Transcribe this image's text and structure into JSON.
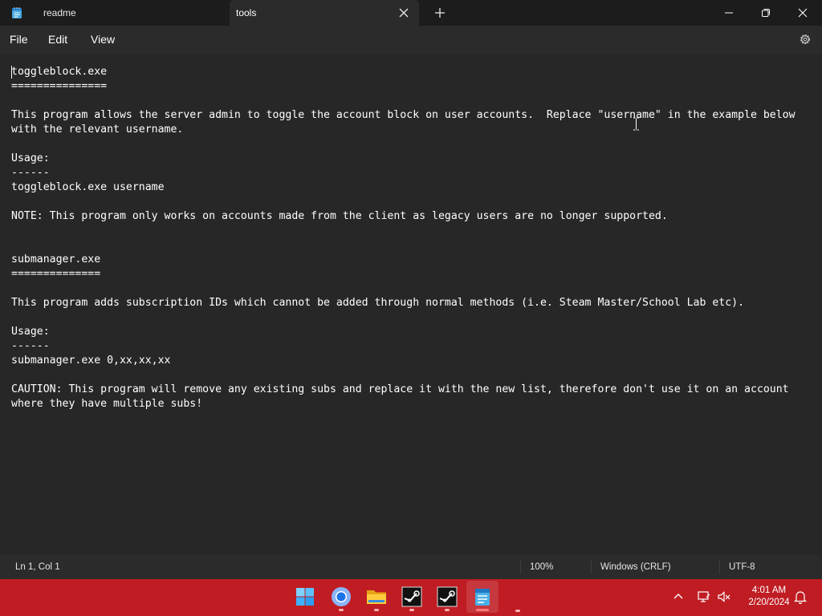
{
  "tabs": [
    {
      "label": "readme",
      "active": false
    },
    {
      "label": "tools",
      "active": true
    }
  ],
  "menu": {
    "file": "File",
    "edit": "Edit",
    "view": "View"
  },
  "editor": {
    "lines": [
      "toggleblock.exe",
      "===============",
      "",
      "This program allows the server admin to toggle the account block on user accounts.  Replace \"username\" in the example below",
      "with the relevant username.",
      "",
      "Usage:",
      "------",
      "toggleblock.exe username",
      "",
      "NOTE: This program only works on accounts made from the client as legacy users are no longer supported.",
      "",
      "",
      "submanager.exe",
      "==============",
      "",
      "This program adds subscription IDs which cannot be added through normal methods (i.e. Steam Master/School Lab etc).",
      "",
      "Usage:",
      "------",
      "submanager.exe 0,xx,xx,xx",
      "",
      "CAUTION: This program will remove any existing subs and replace it with the new list, therefore don't use it on an account",
      "where they have multiple subs!"
    ]
  },
  "status": {
    "position": "Ln 1, Col 1",
    "zoom": "100%",
    "line_ending": "Windows (CRLF)",
    "encoding": "UTF-8"
  },
  "taskbar": {
    "apps": [
      "windows-start-icon",
      "chrome-icon",
      "file-explorer-icon",
      "steam-icon",
      "steam-icon",
      "notepad-icon"
    ],
    "time": "4:01 AM",
    "date": "2/20/2024"
  },
  "colors": {
    "taskbar": "#bf1d23",
    "editor_bg": "#272727",
    "chrome_bg": "#1c1c1c"
  }
}
